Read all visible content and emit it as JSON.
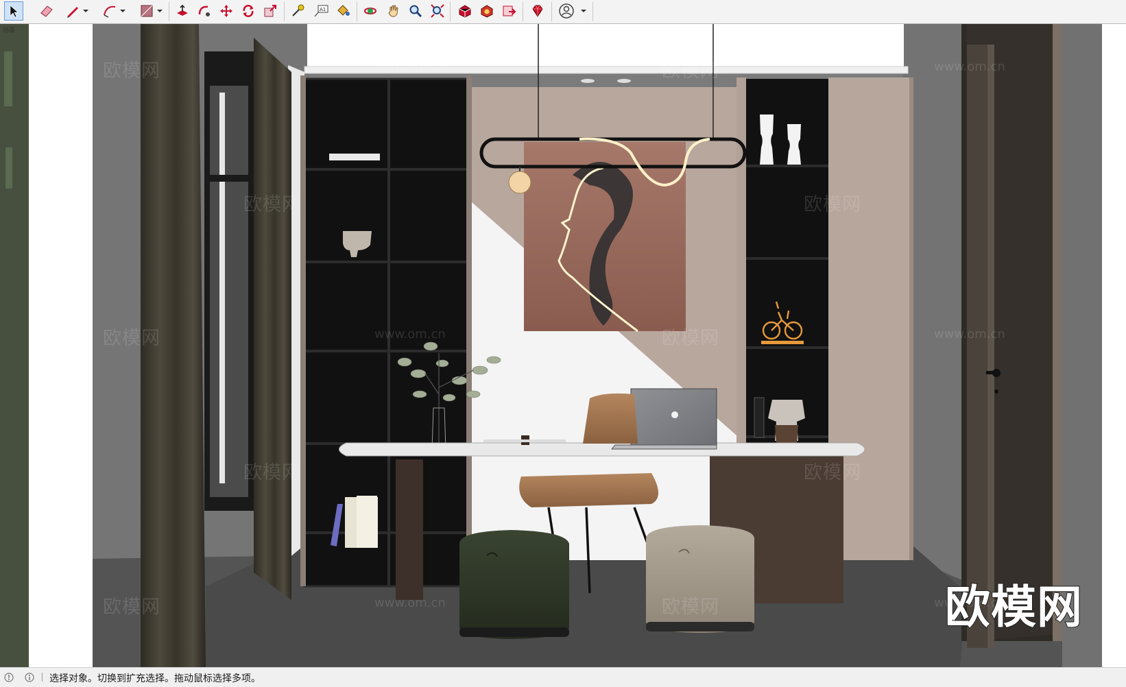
{
  "viewport": {
    "tab_label": "场景"
  },
  "watermark": {
    "chinese": "欧模网",
    "url": "www.om.cn",
    "brand": "欧模网"
  },
  "statusbar": {
    "message": "选择对象。切换到扩充选择。拖动鼠标选择多项。"
  },
  "toolbar": {
    "tools": [
      {
        "icon": "select-arrow-icon",
        "active": true
      },
      {
        "icon": "eraser-icon"
      },
      {
        "icon": "pencil-line-icon"
      },
      {
        "icon": "arc-icon"
      },
      {
        "icon": "rectangle-shape-icon"
      },
      {
        "icon": "push-pull-icon"
      },
      {
        "icon": "follow-me-icon"
      },
      {
        "icon": "move-icon"
      },
      {
        "icon": "rotate-icon"
      },
      {
        "icon": "scale-icon"
      },
      {
        "icon": "tape-measure-icon"
      },
      {
        "icon": "text-label-icon"
      },
      {
        "icon": "paint-bucket-icon"
      },
      {
        "icon": "orbit-icon"
      },
      {
        "icon": "pan-hand-icon"
      },
      {
        "icon": "zoom-icon"
      },
      {
        "icon": "zoom-extents-icon"
      },
      {
        "icon": "warehouse-icon"
      },
      {
        "icon": "extension-warehouse-icon"
      },
      {
        "icon": "layout-send-icon"
      },
      {
        "icon": "ruby-console-icon"
      },
      {
        "icon": "account-icon"
      }
    ]
  }
}
